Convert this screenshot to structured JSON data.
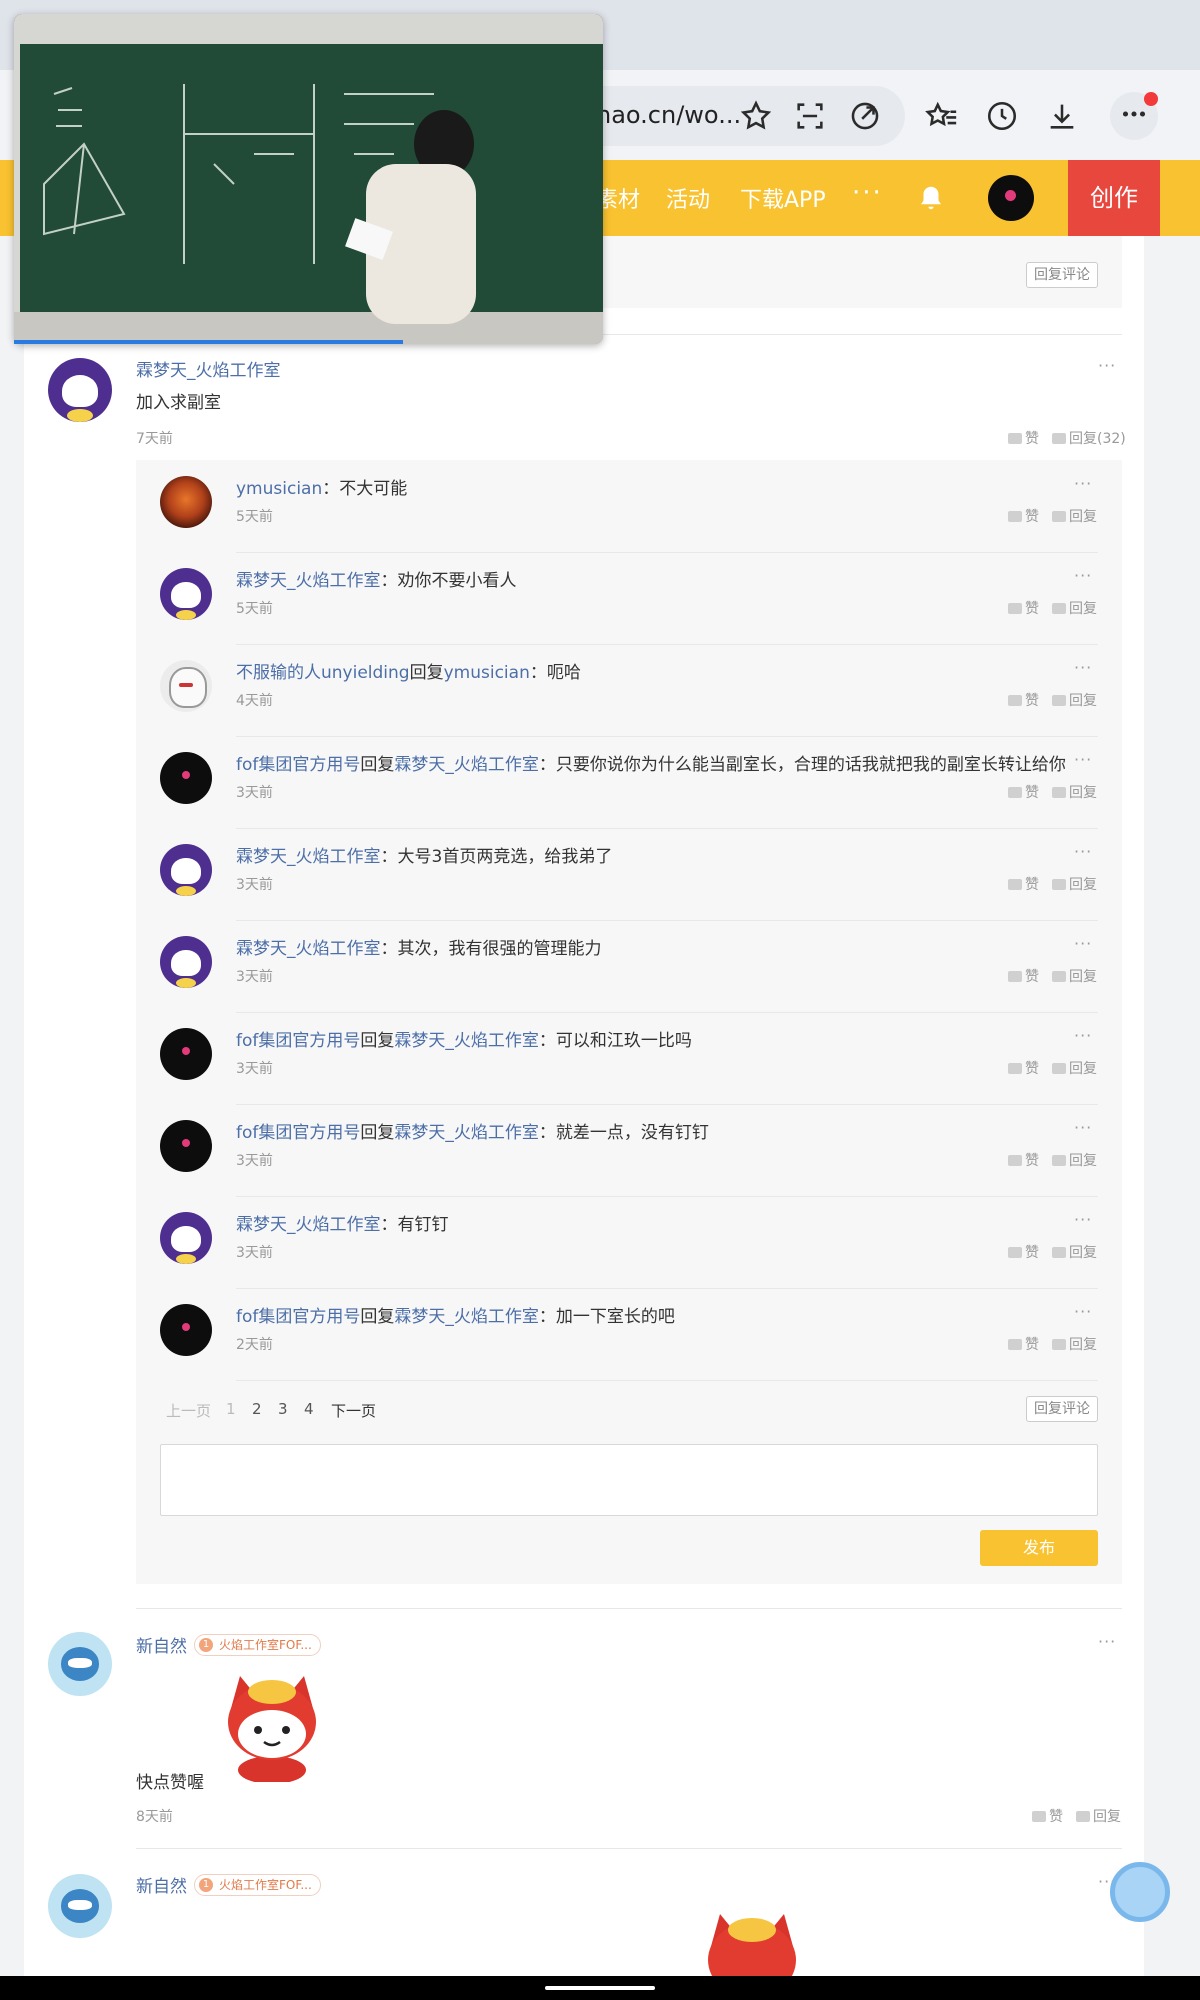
{
  "browser": {
    "url": "hao.cn/wo..."
  },
  "site_nav": {
    "items": [
      "素材",
      "活动",
      "下载APP"
    ],
    "more": "···",
    "create_label": "创作"
  },
  "top_reply_button": "回复评论",
  "comment1": {
    "username": "霖梦天_火焰工作室",
    "text": "加入求副室",
    "time": "7天前",
    "like_label": "赞",
    "reply_label": "回复(32)",
    "more": "···"
  },
  "replies": [
    {
      "user": "ymusician",
      "reply_to": "",
      "text": "：不大可能",
      "time": "5天前"
    },
    {
      "user": "霖梦天_火焰工作室",
      "reply_to": "",
      "text": "：劝你不要小看人",
      "time": "5天前"
    },
    {
      "user": "不服输的人unyielding",
      "reply_to": "ymusician",
      "text": "：呃哈",
      "time": "4天前"
    },
    {
      "user": "fof集团官方用号",
      "reply_to": "霖梦天_火焰工作室",
      "text": "：只要你说你为什么能当副室长，合理的话我就把我的副室长转让给你",
      "time": "3天前"
    },
    {
      "user": "霖梦天_火焰工作室",
      "reply_to": "",
      "text": "：大号3首页两竞选，给我弟了",
      "time": "3天前"
    },
    {
      "user": "霖梦天_火焰工作室",
      "reply_to": "",
      "text": "：其次，我有很强的管理能力",
      "time": "3天前"
    },
    {
      "user": "fof集团官方用号",
      "reply_to": "霖梦天_火焰工作室",
      "text": "：可以和江玖一比吗",
      "time": "3天前"
    },
    {
      "user": "fof集团官方用号",
      "reply_to": "霖梦天_火焰工作室",
      "text": "：就差一点，没有钉钉",
      "time": "3天前"
    },
    {
      "user": "霖梦天_火焰工作室",
      "reply_to": "",
      "text": "：有钉钉",
      "time": "3天前"
    },
    {
      "user": "fof集团官方用号",
      "reply_to": "霖梦天_火焰工作室",
      "text": "：加一下室长的吧",
      "time": "2天前"
    }
  ],
  "reply_word": "回复",
  "like_word": "赞",
  "more_glyph": "···",
  "pagination": {
    "prev": "上一页",
    "pages": [
      "1",
      "2",
      "3",
      "4"
    ],
    "next": "下一页",
    "reply_comment": "回复评论"
  },
  "publish_label": "发布",
  "comment2": {
    "username": "新自然",
    "badge": "火焰工作室FOF...",
    "text": "快点赞喔",
    "time": "8天前",
    "like_label": "赞",
    "reply_label": "回复"
  },
  "comment3": {
    "username": "新自然",
    "badge": "火焰工作室FOF..."
  },
  "video": {
    "progress": 0.66
  }
}
